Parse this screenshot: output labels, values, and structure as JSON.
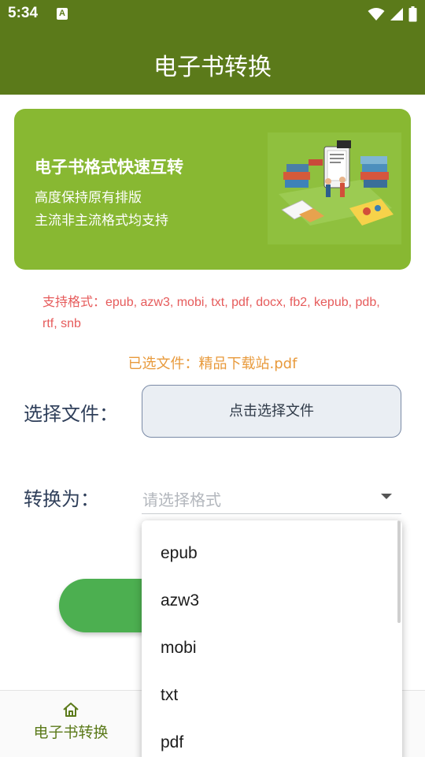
{
  "status_bar": {
    "time": "5:34",
    "notification_letter": "A",
    "icons": [
      "wifi-icon",
      "signal-icon",
      "battery-icon"
    ]
  },
  "app_bar": {
    "title": "电子书转换"
  },
  "banner": {
    "title": "电子书格式快速互转",
    "line1": "高度保持原有排版",
    "line2": "主流非主流格式均支持"
  },
  "formats_text": "支持格式：epub, azw3, mobi, txt, pdf, docx, fb2, kepub, pdb, rtf, snb",
  "selected_file": "已选文件：精品下载站.pdf",
  "select_file": {
    "label": "选择文件：",
    "button_label": "点击选择文件"
  },
  "convert_to": {
    "label": "转换为：",
    "placeholder": "请选择格式"
  },
  "dropdown": {
    "options": [
      "epub",
      "azw3",
      "mobi",
      "txt",
      "pdf"
    ]
  },
  "bottom_nav": {
    "home_label": "电子书转换"
  },
  "colors": {
    "primary": "#5b7a1a",
    "banner": "#88b832",
    "formats_text": "#e65b5b",
    "selected_file": "#e89a3c",
    "convert_button": "#4caf50"
  }
}
